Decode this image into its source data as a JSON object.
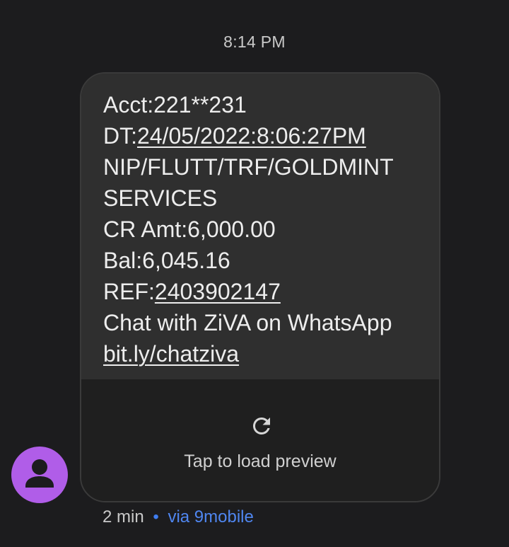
{
  "header": {
    "timestamp": "8:14 PM"
  },
  "message": {
    "lines": [
      {
        "prefix": "Acct:221**231",
        "link": ""
      },
      {
        "prefix": "DT:",
        "link": "24/05/2022:8:06:27PM"
      },
      {
        "prefix": "NIP/FLUTT/TRF/GOLDMINT",
        "link": ""
      },
      {
        "prefix": "SERVICES",
        "link": ""
      },
      {
        "prefix": "CR Amt:6,000.00",
        "link": ""
      },
      {
        "prefix": "Bal:6,045.16",
        "link": ""
      },
      {
        "prefix": "REF:",
        "link": "2403902147"
      },
      {
        "prefix": "Chat with ZiVA on WhatsApp",
        "link": ""
      },
      {
        "prefix": "",
        "link": "bit.ly/chatziva"
      }
    ]
  },
  "preview": {
    "icon": "refresh-icon",
    "label": "Tap to load preview"
  },
  "footer": {
    "time_ago": "2 min",
    "separator": "•",
    "via": "via 9mobile"
  },
  "colors": {
    "background": "#1c1c1e",
    "bubble": "#2f2f2f",
    "avatar": "#b05de8",
    "accent": "#4f86f0"
  }
}
